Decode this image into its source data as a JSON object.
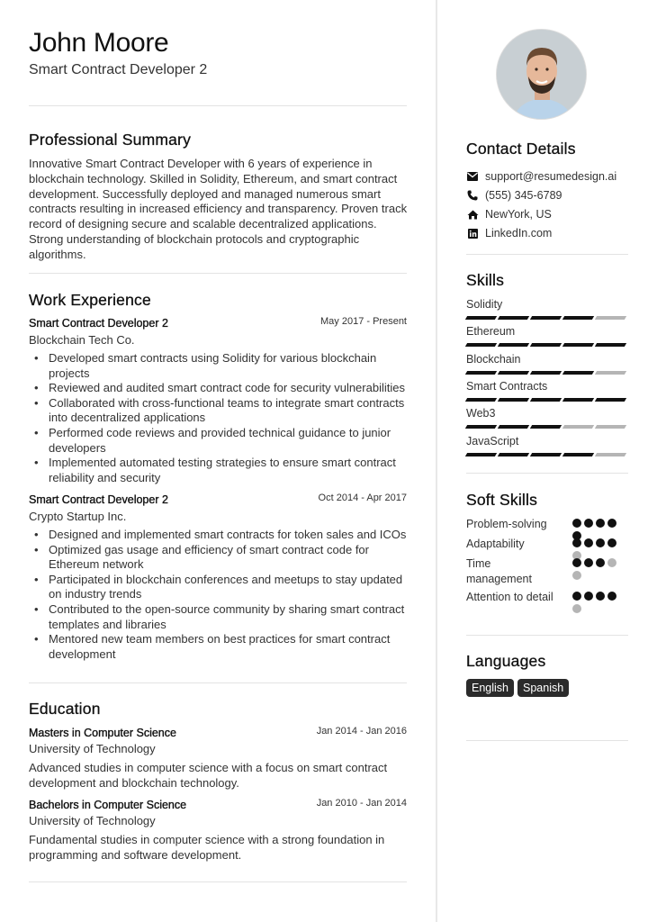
{
  "header": {
    "name": "John Moore",
    "title": "Smart Contract Developer 2"
  },
  "summary": {
    "heading": "Professional Summary",
    "text": "Innovative Smart Contract Developer with 6 years of experience in blockchain technology. Skilled in Solidity, Ethereum, and smart contract development. Successfully deployed and managed numerous smart contracts resulting in increased efficiency and transparency. Proven track record of designing secure and scalable decentralized applications. Strong understanding of blockchain protocols and cryptographic algorithms."
  },
  "experience": {
    "heading": "Work Experience",
    "jobs": [
      {
        "title": "Smart Contract Developer 2",
        "dates": "May 2017 - Present",
        "company": "Blockchain Tech Co.",
        "bullets": [
          "Developed smart contracts using Solidity for various blockchain projects",
          "Reviewed and audited smart contract code for security vulnerabilities",
          "Collaborated with cross-functional teams to integrate smart contracts into decentralized applications",
          "Performed code reviews and provided technical guidance to junior developers",
          "Implemented automated testing strategies to ensure smart contract reliability and security"
        ]
      },
      {
        "title": "Smart Contract Developer 2",
        "dates": "Oct 2014 - Apr 2017",
        "company": "Crypto Startup Inc.",
        "bullets": [
          "Designed and implemented smart contracts for token sales and ICOs",
          "Optimized gas usage and efficiency of smart contract code for Ethereum network",
          "Participated in blockchain conferences and meetups to stay updated on industry trends",
          "Contributed to the open-source community by sharing smart contract templates and libraries",
          "Mentored new team members on best practices for smart contract development"
        ]
      }
    ]
  },
  "education": {
    "heading": "Education",
    "items": [
      {
        "degree": "Masters in Computer Science",
        "dates": "Jan 2014 - Jan 2016",
        "school": "University of Technology",
        "description": "Advanced studies in computer science with a focus on smart contract development and blockchain technology."
      },
      {
        "degree": "Bachelors in Computer Science",
        "dates": "Jan 2010 - Jan 2014",
        "school": "University of Technology",
        "description": "Fundamental studies in computer science with a strong foundation in programming and software development."
      }
    ]
  },
  "contact": {
    "heading": "Contact Details",
    "items": [
      {
        "icon": "envelope-icon",
        "text": "support@resumedesign.ai"
      },
      {
        "icon": "phone-icon",
        "text": "(555) 345-6789"
      },
      {
        "icon": "home-icon",
        "text": "NewYork, US"
      },
      {
        "icon": "linkedin-icon",
        "text": "LinkedIn.com"
      }
    ]
  },
  "skills": {
    "heading": "Skills",
    "max": 5,
    "items": [
      {
        "name": "Solidity",
        "level": 4
      },
      {
        "name": "Ethereum",
        "level": 5
      },
      {
        "name": "Blockchain",
        "level": 4
      },
      {
        "name": "Smart Contracts",
        "level": 5
      },
      {
        "name": "Web3",
        "level": 3
      },
      {
        "name": "JavaScript",
        "level": 4
      }
    ]
  },
  "soft_skills": {
    "heading": "Soft Skills",
    "max": 5,
    "items": [
      {
        "name": "Problem-solving",
        "level": 5
      },
      {
        "name": "Adaptability",
        "level": 4
      },
      {
        "name": "Time management",
        "level": 3
      },
      {
        "name": "Attention to detail",
        "level": 4
      }
    ]
  },
  "languages": {
    "heading": "Languages",
    "items": [
      "English",
      "Spanish"
    ]
  },
  "colors": {
    "filled": "#111111",
    "empty": "#b5b5b5",
    "tag_bg": "#2b2b2b"
  }
}
